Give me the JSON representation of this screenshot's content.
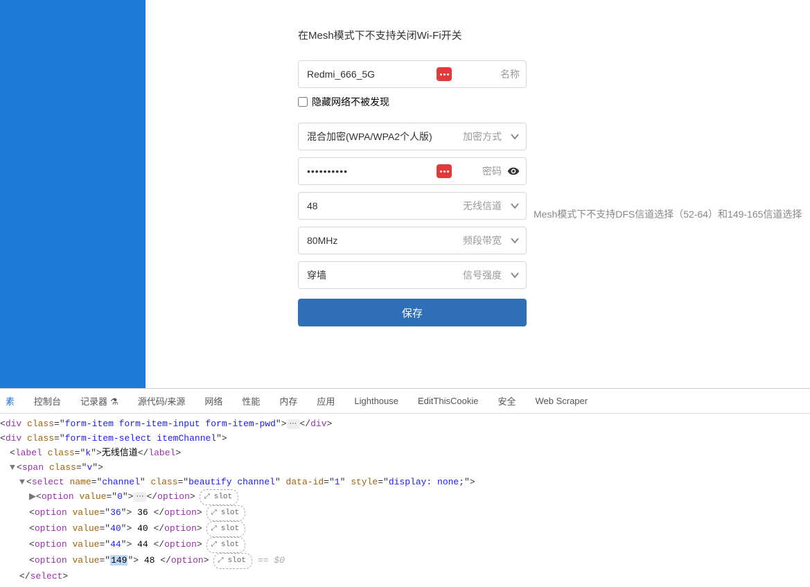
{
  "notice": "在Mesh模式下不支持关闭Wi-Fi开关",
  "name_field": {
    "value": "Redmi_666_5G",
    "label": "名称"
  },
  "hide_network_label": "隐藏网络不被发现",
  "encryption": {
    "value": "混合加密(WPA/WPA2个人版)",
    "label": "加密方式"
  },
  "password": {
    "value": "••••••••••",
    "label": "密码"
  },
  "channel": {
    "value": "48",
    "label": "无线信道"
  },
  "bandwidth": {
    "value": "80MHz",
    "label": "频段带宽"
  },
  "signal": {
    "value": "穿墙",
    "label": "信号强度"
  },
  "channel_note": "Mesh模式下不支持DFS信道选择（52-64）和149-165信道选择",
  "save_label": "保存",
  "dev_tabs": [
    "素",
    "控制台",
    "记录器",
    "源代码/来源",
    "网络",
    "性能",
    "内存",
    "应用",
    "Lighthouse",
    "EditThisCookie",
    "安全",
    "Web Scraper"
  ],
  "dom": {
    "pwd_class": "form-item form-item-input form-item-pwd",
    "select_class": "form-item-select itemChannel",
    "label_class": "k",
    "label_text": "无线信道",
    "span_class": "v",
    "select_name": "channel",
    "select_beautify_class": "beautify channel",
    "select_data_id": "1",
    "select_style": "display: none;",
    "options": [
      {
        "value": "0",
        "text": "",
        "ellipsis": true
      },
      {
        "value": "36",
        "text": "36"
      },
      {
        "value": "40",
        "text": "40"
      },
      {
        "value": "44",
        "text": "44"
      },
      {
        "value": "149",
        "text": "48",
        "editing": true,
        "eq0": true
      }
    ],
    "slot_word": "slot",
    "eq0": "== $0"
  }
}
